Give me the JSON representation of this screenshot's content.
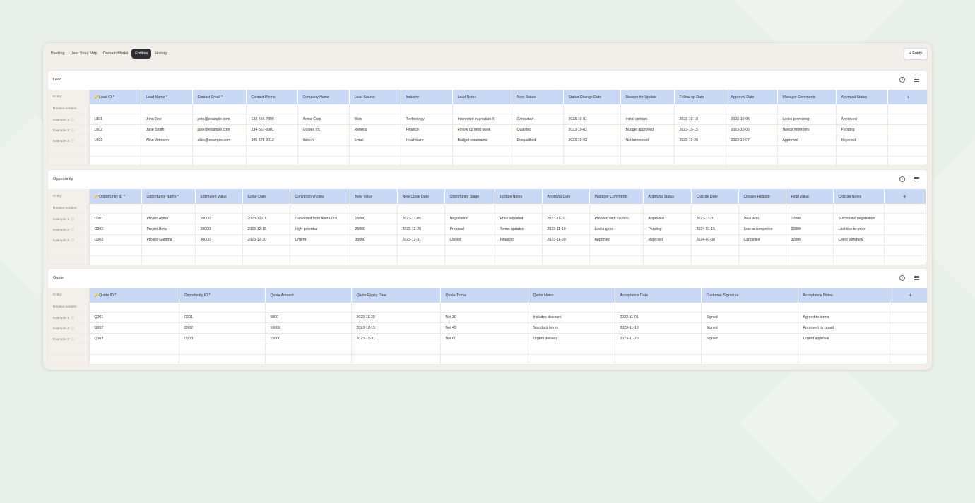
{
  "tabs": [
    {
      "label": "Backlog",
      "active": false
    },
    {
      "label": "User Story Map",
      "active": false
    },
    {
      "label": "Domain Model",
      "active": false
    },
    {
      "label": "Entities",
      "active": true
    },
    {
      "label": "History",
      "active": false
    }
  ],
  "add_entity_label": "+ Entity",
  "row_labels": {
    "entity": "Entity:",
    "related": "Related entities:",
    "examples": [
      "Example 1: ⓘ",
      "Example 2: ⓘ",
      "Example 3: ⓘ"
    ]
  },
  "add_column_label": "+",
  "entities": [
    {
      "title": "Lead",
      "columns": [
        "Lead ID *",
        "Lead Name *",
        "Contact Email *",
        "Contact Phone",
        "Company Name",
        "Lead Source",
        "Industry",
        "Lead Notes",
        "New Status",
        "Status Change Date",
        "Reason for Update",
        "Follow-up Date",
        "Approval Date",
        "Manager Comments",
        "Approval Status"
      ],
      "rows": [
        [
          "L001",
          "John Doe",
          "john@example.com",
          "123-456-7890",
          "Acme Corp",
          "Web",
          "Technology",
          "Interested in product X",
          "Contacted",
          "2023-10-01",
          "Initial contact",
          "2023-10-10",
          "2023-10-05",
          "Looks promising",
          "Approved"
        ],
        [
          "L002",
          "Jane Smith",
          "jane@example.com",
          "234-567-8901",
          "Globex Inc",
          "Referral",
          "Finance",
          "Follow up next week",
          "Qualified",
          "2023-10-02",
          "Budget approved",
          "2023-10-15",
          "2023-10-06",
          "Needs more info",
          "Pending"
        ],
        [
          "L003",
          "Alice Johnson",
          "alice@example.com",
          "345-678-9012",
          "Initech",
          "Email",
          "Healthcare",
          "Budget constraints",
          "Disqualified",
          "2023-10-03",
          "Not interested",
          "2023-10-20",
          "2023-10-07",
          "Approved",
          "Rejected"
        ]
      ]
    },
    {
      "title": "Opportunity",
      "columns": [
        "Opportunity ID *",
        "Opportunity Name *",
        "Estimated Value",
        "Close Date",
        "Conversion Notes",
        "New Value",
        "New Close Date",
        "Opportunity Stage",
        "Update Notes",
        "Approval Date",
        "Manager Comments",
        "Approval Status",
        "Closure Date",
        "Closure Reason",
        "Final Value",
        "Closure Notes"
      ],
      "rows": [
        [
          "O001",
          "Project Alpha",
          "10000",
          "2023-12-01",
          "Converted from lead L001",
          "15000",
          "2023-12-05",
          "Negotiation",
          "Price adjusted",
          "2023-11-01",
          "Proceed with caution",
          "Approved",
          "2023-12-31",
          "Deal won",
          "12000",
          "Successful negotiation"
        ],
        [
          "O002",
          "Project Beta",
          "20000",
          "2023-12-15",
          "High potential",
          "25000",
          "2023-12-20",
          "Proposal",
          "Terms updated",
          "2023-11-10",
          "Looks good",
          "Pending",
          "2024-01-15",
          "Lost to competitor",
          "22000",
          "Lost due to price"
        ],
        [
          "O003",
          "Project Gamma",
          "30000",
          "2023-12-30",
          "Urgent",
          "35000",
          "2023-12-31",
          "Closed",
          "Finalized",
          "2023-11-20",
          "Approved",
          "Rejected",
          "2024-01-30",
          "Cancelled",
          "32000",
          "Client withdrew"
        ]
      ]
    },
    {
      "title": "Quote",
      "columns": [
        "Quote ID *",
        "Opportunity ID *",
        "Quote Amount",
        "Quote Expiry Date",
        "Quote Terms",
        "Quote Notes",
        "Acceptance Date",
        "Customer Signature",
        "Acceptance Notes"
      ],
      "rows": [
        [
          "Q001",
          "O001",
          "5000",
          "2023-11-30",
          "Net 30",
          "Includes discount",
          "2023-11-01",
          "Signed",
          "Agreed to terms"
        ],
        [
          "Q002",
          "O002",
          "10000",
          "2023-12-15",
          "Net 45",
          "Standard terms",
          "2023-11-10",
          "Signed",
          "Approved by board"
        ],
        [
          "Q003",
          "O003",
          "15000",
          "2023-12-31",
          "Net 60",
          "Urgent delivery",
          "2023-11-20",
          "Signed",
          "Urgent approval"
        ]
      ]
    }
  ]
}
